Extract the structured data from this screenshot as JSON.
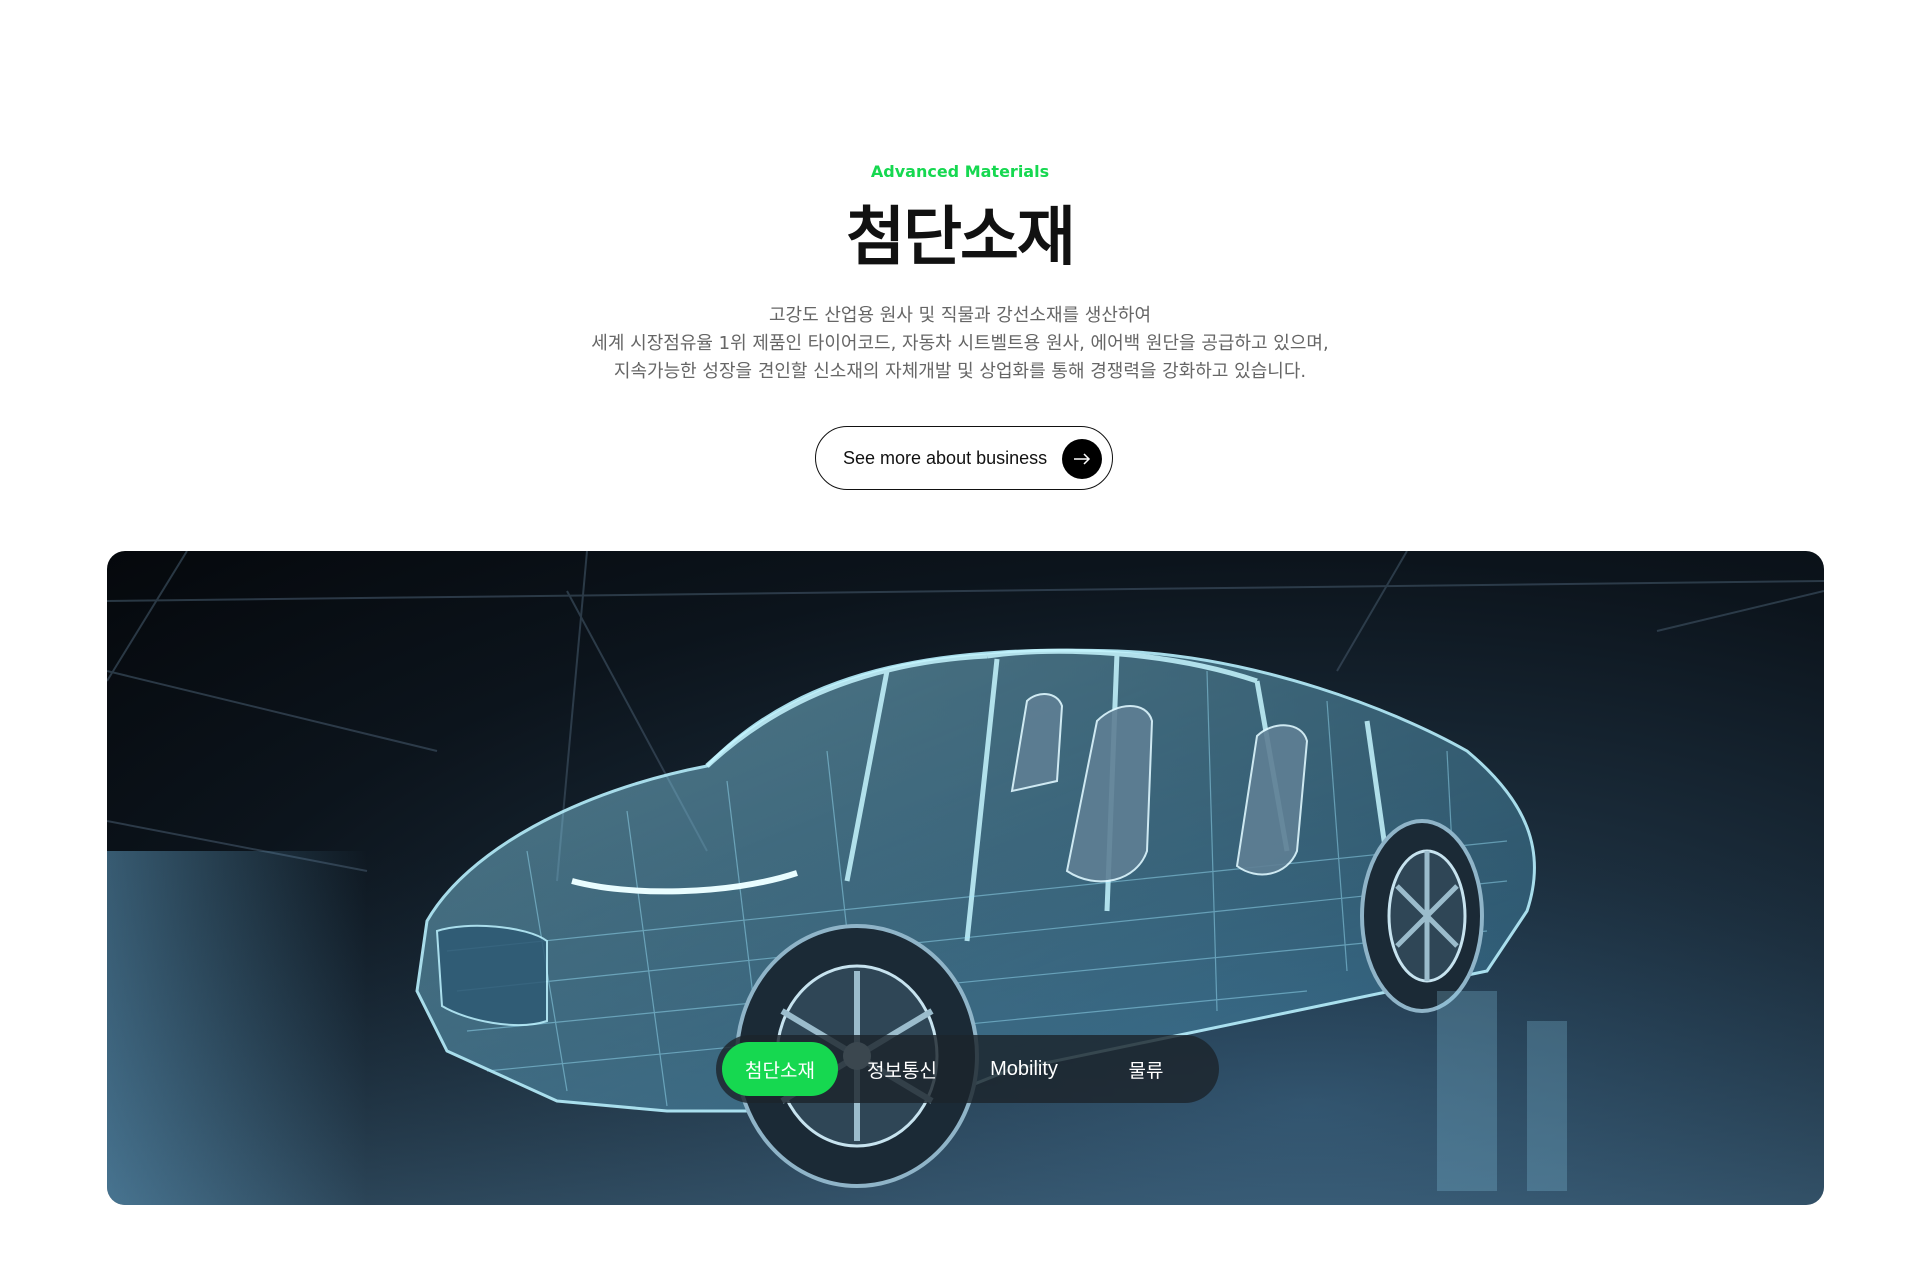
{
  "section": {
    "eyebrow": "Advanced Materials",
    "title": "첨단소재",
    "description": [
      "고강도 산업용 원사 및 직물과 강선소재를 생산하여",
      "세계 시장점유율 1위 제품인 타이어코드, 자동차 시트벨트용 원사, 에어백 원단을 공급하고 있으며,",
      "지속가능한 성장을 견인할 신소재의 자체개발 및 상업화를 통해 경쟁력을 강화하고 있습니다."
    ],
    "cta_label": "See more about business",
    "cta_icon": "arrow-right-icon"
  },
  "hero": {
    "image": "wireframe-car-image",
    "tabs": [
      {
        "label": "첨단소재",
        "active": true
      },
      {
        "label": "정보통신",
        "active": false
      },
      {
        "label": "Mobility",
        "active": false
      },
      {
        "label": "물류",
        "active": false
      }
    ]
  },
  "colors": {
    "accent": "#16d850",
    "text_dark": "#111111",
    "text_muted": "#666666"
  }
}
